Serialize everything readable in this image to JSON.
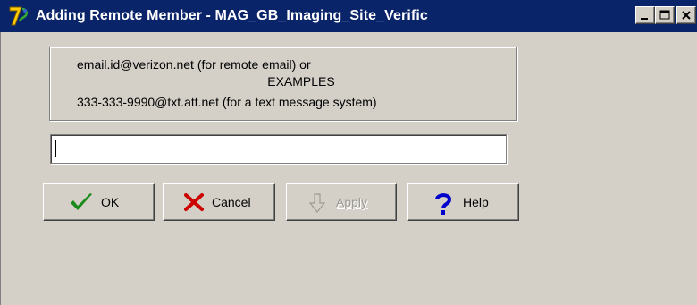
{
  "window": {
    "title": "Adding Remote Member  - MAG_GB_Imaging_Site_Verific",
    "app_icon": "app-7-logo-icon",
    "controls": {
      "minimize": "minimize-icon",
      "maximize": "maximize-icon",
      "close": "close-icon"
    }
  },
  "examples": {
    "line1": "email.id@verizon.net (for remote email) or",
    "line2": "EXAMPLES",
    "line3": "333-333-9990@txt.att.net (for a text message system)"
  },
  "email_input": {
    "value": "",
    "placeholder": ""
  },
  "buttons": {
    "ok": {
      "label": "OK",
      "icon": "checkmark-icon",
      "color": "#1a8a1a"
    },
    "cancel": {
      "label": "Cancel",
      "icon": "x-icon",
      "color": "#cc0000"
    },
    "apply": {
      "label": "Apply",
      "icon": "arrow-down-icon",
      "disabled": true
    },
    "help": {
      "label": "Help",
      "icon": "question-mark-icon",
      "color": "#0000cc"
    }
  },
  "colors": {
    "titlebar": "#0a246a",
    "face": "#d4d0c8"
  }
}
